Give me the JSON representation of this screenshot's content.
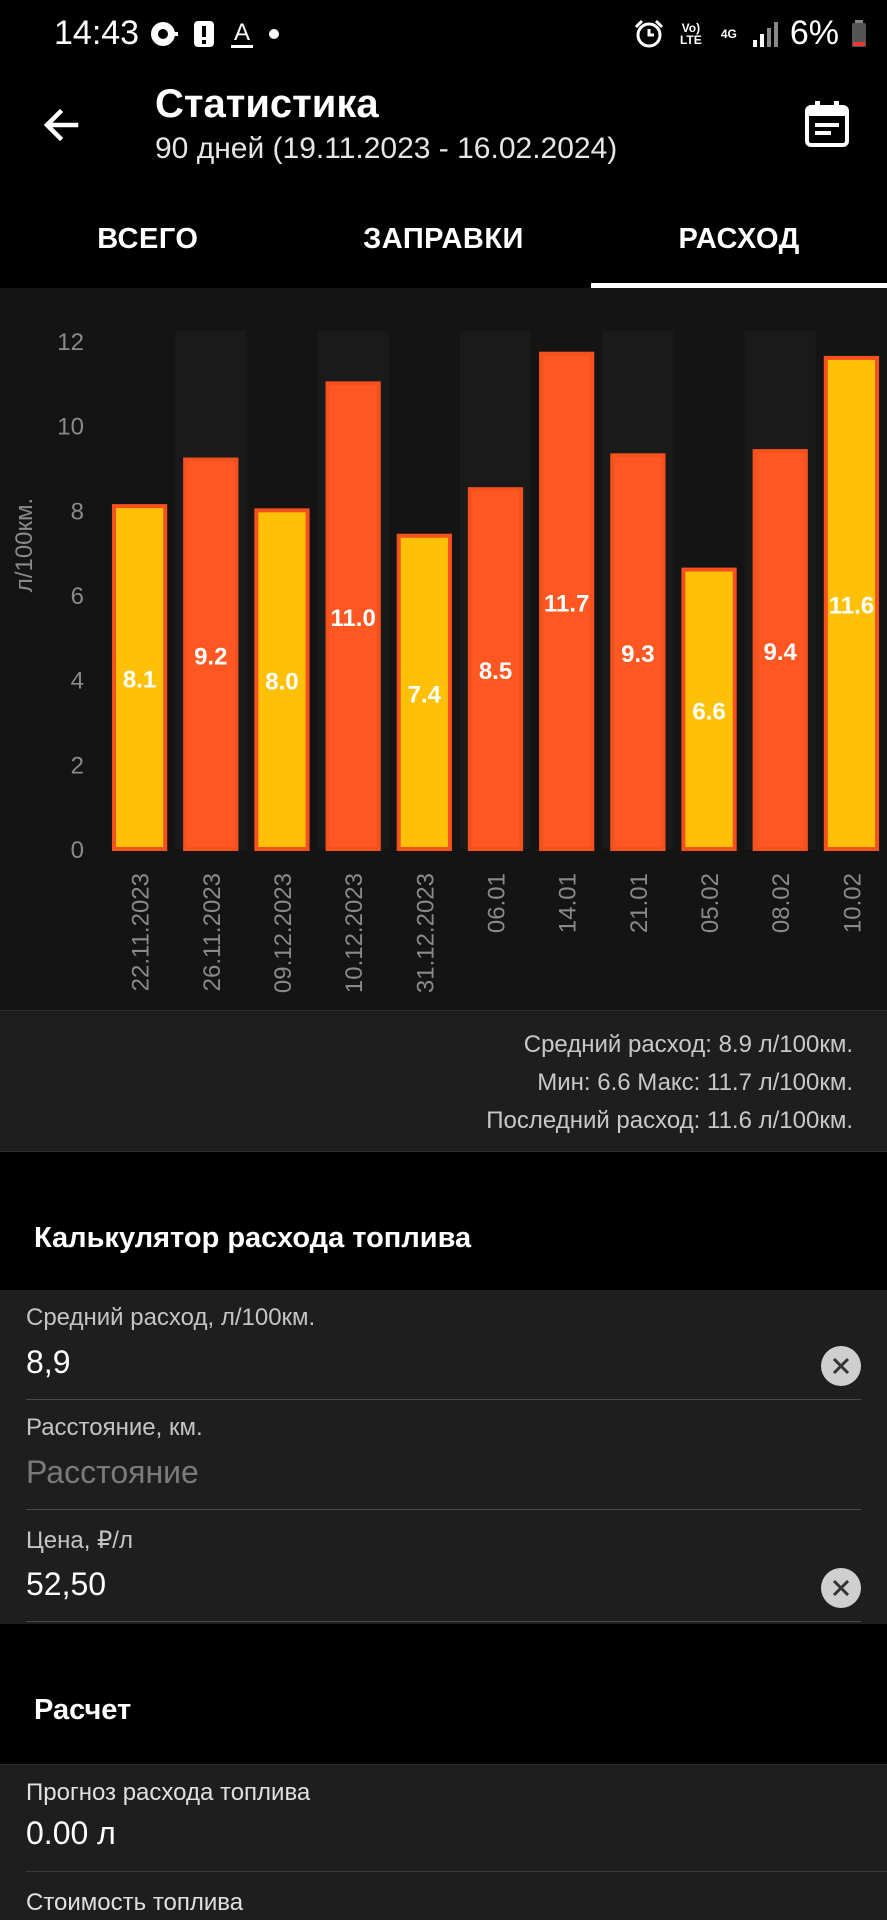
{
  "status_bar": {
    "time": "14:43",
    "network_label": "4G",
    "volte_label": "Vo) LTE",
    "battery": "6%"
  },
  "app_bar": {
    "title": "Статистика",
    "subtitle": "90 дней (19.11.2023 - 16.02.2024)",
    "back_icon": "arrow-left-icon",
    "calendar_icon": "calendar-icon"
  },
  "tabs": [
    {
      "label": "ВСЕГО",
      "active": false
    },
    {
      "label": "ЗАПРАВКИ",
      "active": false
    },
    {
      "label": "РАСХОД",
      "active": true
    }
  ],
  "chart_data": {
    "type": "bar",
    "categories": [
      "22.11.2023",
      "26.11.2023",
      "09.12.2023",
      "10.12.2023",
      "31.12.2023",
      "06.01",
      "14.01",
      "21.01",
      "05.02",
      "08.02",
      "10.02"
    ],
    "values": [
      8.1,
      9.2,
      8.0,
      11.0,
      7.4,
      8.5,
      11.7,
      9.3,
      6.6,
      9.4,
      11.6
    ],
    "labels": [
      "8.1",
      "9.2",
      "8.0",
      "11.0",
      "7.4",
      "8.5",
      "11.7",
      "9.3",
      "6.6",
      "9.4",
      "11.6"
    ],
    "bar_colors": [
      "#FFC107",
      "#FF5722",
      "#FFC107",
      "#FF5722",
      "#FFC107",
      "#FF5722",
      "#FF5722",
      "#FF5722",
      "#FFC107",
      "#FF5722",
      "#FFC107"
    ],
    "ylabel": "л/100км.",
    "ylim": [
      0,
      12
    ],
    "yticks": [
      "0",
      "2",
      "4",
      "6",
      "8",
      "10",
      "12"
    ],
    "colors": {
      "above_avg": "#FF5722",
      "below_avg": "#FFC107",
      "border": "#F4511E"
    }
  },
  "summary": {
    "avg": "Средний расход: 8.9 л/100км.",
    "minmax": "Мин: 6.6 Макс: 11.7 л/100км.",
    "last": "Последний расход: 11.6 л/100км."
  },
  "calculator": {
    "title": "Калькулятор расхода топлива",
    "avg_label": "Средний расход, л/100км.",
    "avg_value": "8,9",
    "distance_label": "Расстояние, км.",
    "distance_placeholder": "Расстояние",
    "price_label": "Цена, ₽/л",
    "price_value": "52,50"
  },
  "result": {
    "title": "Расчет",
    "forecast_label": "Прогноз расхода топлива",
    "forecast_value": "0.00 л",
    "cost_label": "Стоимость топлива"
  }
}
